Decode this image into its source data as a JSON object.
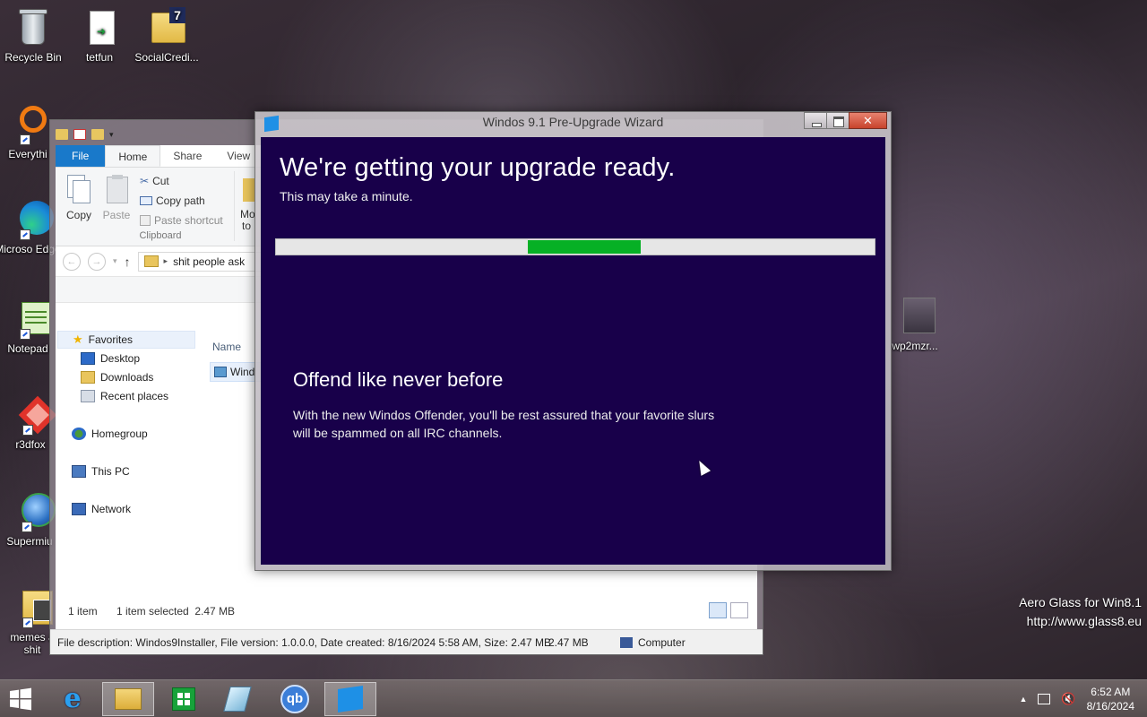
{
  "desktop": {
    "icons": [
      {
        "label": "Recycle Bin"
      },
      {
        "label": "tetfun"
      },
      {
        "label": "SocialCredi..."
      },
      {
        "label": "Everythi"
      },
      {
        "label": "Microso Edge"
      },
      {
        "label": "Notepad"
      },
      {
        "label": "r3dfox"
      },
      {
        "label": "Supermiu"
      },
      {
        "label": "memes a shit"
      },
      {
        "label": "wp2mzr..."
      }
    ]
  },
  "explorer": {
    "tabs": {
      "file": "File",
      "home": "Home",
      "share": "Share",
      "view": "View"
    },
    "ribbon": {
      "copy": "Copy",
      "paste": "Paste",
      "cut": "Cut",
      "copy_path": "Copy path",
      "paste_shortcut": "Paste shortcut",
      "clipboard_group": "Clipboard",
      "move_to": "Mo to"
    },
    "address": {
      "path": "shit people ask"
    },
    "nav": {
      "favorites": "Favorites",
      "desktop": "Desktop",
      "downloads": "Downloads",
      "recent": "Recent places",
      "homegroup": "Homegroup",
      "this_pc": "This PC",
      "network": "Network"
    },
    "column_name": "Name",
    "file_partial": "Wind",
    "status": {
      "count": "1 item",
      "selected": "1 item selected  2.47 MB"
    },
    "infobar": {
      "description": "File description: Windos9Installer, File version: 1.0.0.0, Date created: 8/16/2024 5:58 AM, Size: 2.47 MB",
      "size": "2.47 MB",
      "location": "Computer"
    }
  },
  "wizard": {
    "title": "Windos 9.1 Pre-Upgrade Wizard",
    "heading": "We're getting your upgrade ready.",
    "subheading": "This may take a minute.",
    "progress": {
      "start_fraction": 0.42,
      "end_fraction": 0.61
    },
    "feature_title": "Offend like never before",
    "feature_text": "With the new Windos Offender, you'll be rest assured that your favorite slurs will be spammed on all IRC channels.",
    "close_symbol": "✕"
  },
  "watermark": {
    "line1": "Aero Glass for Win8.1",
    "line2": "http://www.glass8.eu"
  },
  "taskbar": {
    "apps": [
      {
        "icon": "windows-start-icon"
      },
      {
        "icon": "internet-explorer-icon"
      },
      {
        "icon": "file-explorer-icon"
      },
      {
        "icon": "store-icon"
      },
      {
        "icon": "app-icon"
      },
      {
        "icon": "qbittorrent-icon",
        "text": "qb"
      },
      {
        "icon": "wizard-icon"
      }
    ],
    "clock": {
      "time": "6:52 AM",
      "date": "8/16/2024"
    }
  },
  "colors": {
    "wizard_bg": "#18004a",
    "progress_fill": "#06b025",
    "file_tab": "#1979ca"
  }
}
